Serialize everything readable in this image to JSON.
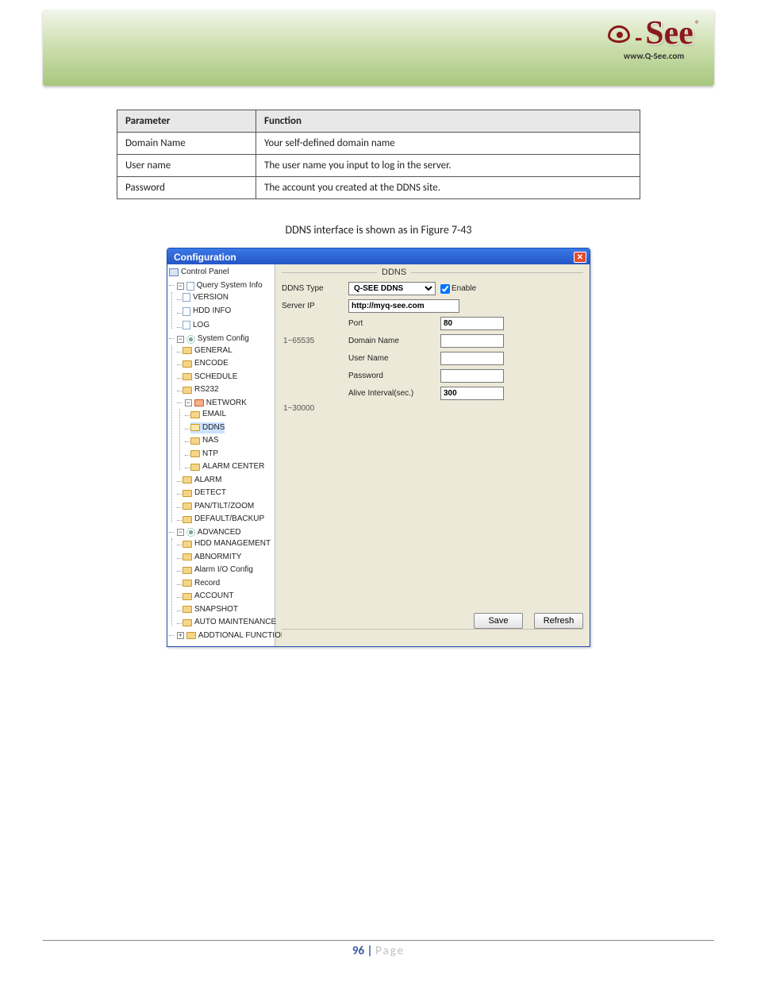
{
  "brand": {
    "name": "Q-See",
    "url": "www.Q-See.com",
    "reg": "®"
  },
  "param_table": {
    "header": [
      "Parameter",
      "Function"
    ],
    "rows": [
      [
        "Domain Name",
        "Your self-defined domain name"
      ],
      [
        "User name",
        "The user name you input to log in the server."
      ],
      [
        "Password",
        "The account you created at the DDNS site."
      ]
    ]
  },
  "caption": "DDNS interface is shown as in Figure 7-43",
  "dialog": {
    "title": "Configuration",
    "close_glyph": "✕",
    "tree": {
      "control_panel": "Control Panel",
      "qsi": {
        "label": "Query System Info",
        "children": [
          "VERSION",
          "HDD INFO",
          "LOG"
        ]
      },
      "sysconf": {
        "label": "System Config",
        "children": [
          "GENERAL",
          "ENCODE",
          "SCHEDULE",
          "RS232"
        ],
        "network": {
          "label": "NETWORK",
          "children": [
            "EMAIL",
            "DDNS",
            "NAS",
            "NTP",
            "ALARM CENTER"
          ]
        },
        "tail": [
          "ALARM",
          "DETECT",
          "PAN/TILT/ZOOM",
          "DEFAULT/BACKUP"
        ]
      },
      "advanced": {
        "label": "ADVANCED",
        "children": [
          "HDD MANAGEMENT",
          "ABNORMITY",
          "Alarm I/O Config",
          "Record",
          "ACCOUNT",
          "SNAPSHOT",
          "AUTO MAINTENANCE"
        ]
      },
      "addl": "ADDTIONAL FUNCTION"
    },
    "panel": {
      "title": "DDNS",
      "labels": {
        "type": "DDNS Type",
        "server_ip": "Server IP",
        "port": "Port",
        "domain": "Domain Name",
        "user": "User Name",
        "password": "Password",
        "alive": "Alive Interval(sec.)"
      },
      "values": {
        "type": "Q-SEE DDNS",
        "enable_label": "Enable",
        "enable_checked": true,
        "server_ip": "http://myq-see.com",
        "port": "80",
        "port_range": "1~65535",
        "domain": "",
        "user": "",
        "password": "",
        "alive": "300",
        "alive_range": "1~30000"
      },
      "buttons": {
        "save": "Save",
        "refresh": "Refresh"
      }
    }
  },
  "footer": {
    "page_no": "96",
    "sep": "|",
    "word": "Page"
  }
}
